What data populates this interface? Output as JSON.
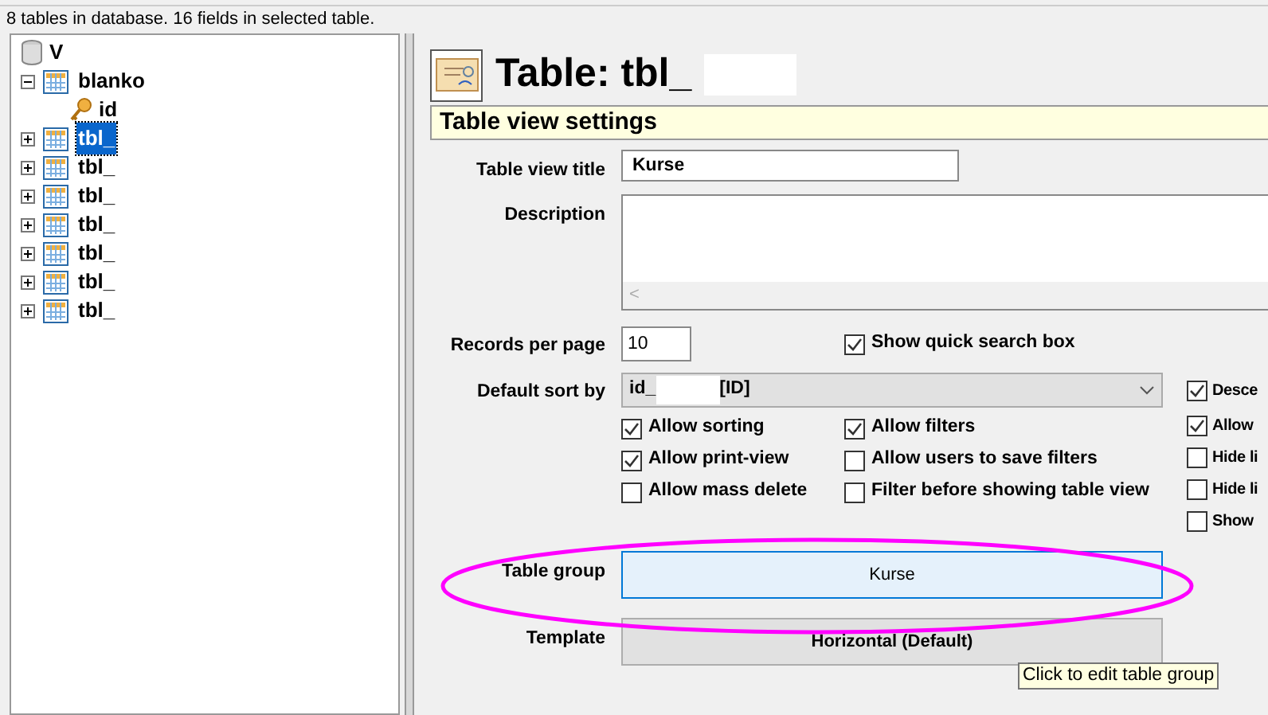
{
  "status_text": "8 tables in database. 16 fields in selected table.",
  "tree": {
    "label": "V",
    "children": [
      {
        "label": "blanko",
        "expanded": true,
        "selected": false,
        "children": [
          {
            "label": "id",
            "kind": "key"
          }
        ]
      },
      {
        "label": "tbl_",
        "expanded": false,
        "selected": true
      },
      {
        "label": "tbl_",
        "expanded": false,
        "selected": false
      },
      {
        "label": "tbl_",
        "expanded": false,
        "selected": false
      },
      {
        "label": "tbl_",
        "expanded": false,
        "selected": false
      },
      {
        "label": "tbl_",
        "expanded": false,
        "selected": false
      },
      {
        "label": "tbl_",
        "expanded": false,
        "selected": false
      },
      {
        "label": "tbl_",
        "expanded": false,
        "selected": false
      }
    ]
  },
  "heading": "Table: tbl_",
  "section_title": "Table view settings",
  "form": {
    "title_label": "Table view title",
    "title_value": "Kurse",
    "description_label": "Description",
    "scroll_left": "<",
    "records_label": "Records per page",
    "records_value": "10",
    "sort_label": "Default sort by",
    "sort_value_prefix": "id_",
    "sort_value_suffix": "[ID]",
    "table_group_label": "Table group",
    "table_group_value": "Kurse",
    "template_label": "Template",
    "template_value": "Horizontal (Default)"
  },
  "quick_search_option": {
    "label": "Show quick search box",
    "checked": true
  },
  "option_columns": [
    [
      {
        "label": "Allow sorting",
        "checked": true
      },
      {
        "label": "Allow print-view",
        "checked": true
      },
      {
        "label": "Allow mass delete",
        "checked": false
      }
    ],
    [
      {
        "label": "Allow filters",
        "checked": true
      },
      {
        "label": "Allow users to save filters",
        "checked": false
      },
      {
        "label": "Filter before showing table view",
        "checked": false
      }
    ],
    [
      {
        "label": "Desce",
        "checked": true
      },
      {
        "label": "Allow",
        "checked": true
      },
      {
        "label": "Hide li",
        "checked": false
      },
      {
        "label": "Hide li",
        "checked": false
      },
      {
        "label": "Show",
        "checked": false
      }
    ]
  ],
  "tooltip": "Click to edit table group"
}
